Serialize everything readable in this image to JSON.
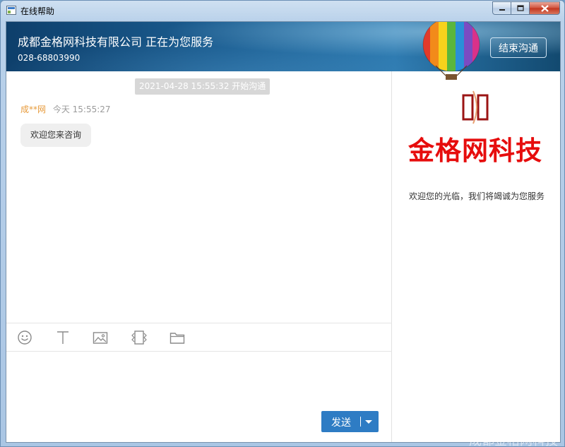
{
  "window": {
    "title": "在线帮助",
    "controls": {
      "minimize_icon": "minimize-icon",
      "maximize_icon": "maximize-icon",
      "close_icon": "close-icon"
    }
  },
  "header": {
    "title": "成都金格网科技有限公司 正在为您服务",
    "phone": "028-68803990",
    "end_chat_label": "结束沟通"
  },
  "chat": {
    "session_start": "2021-04-28 15:55:32 开始沟通",
    "messages": [
      {
        "sender": "成**网",
        "time": "今天 15:55:27",
        "text": "欢迎您来咨询"
      }
    ]
  },
  "toolbar": {
    "tools": [
      "emoji-icon",
      "text-format-icon",
      "image-icon",
      "screenshot-icon",
      "folder-icon"
    ]
  },
  "composer": {
    "value": "",
    "send_label": "发送"
  },
  "sidebar": {
    "logo_text": "金格网科技",
    "welcome": "欢迎您的光临，我们将竭诚为您服务"
  },
  "watermark": "成都金格网科技",
  "colors": {
    "brand_red": "#e60d0d",
    "send_blue": "#2e7cc4",
    "sender_orange": "#e79a3a"
  }
}
